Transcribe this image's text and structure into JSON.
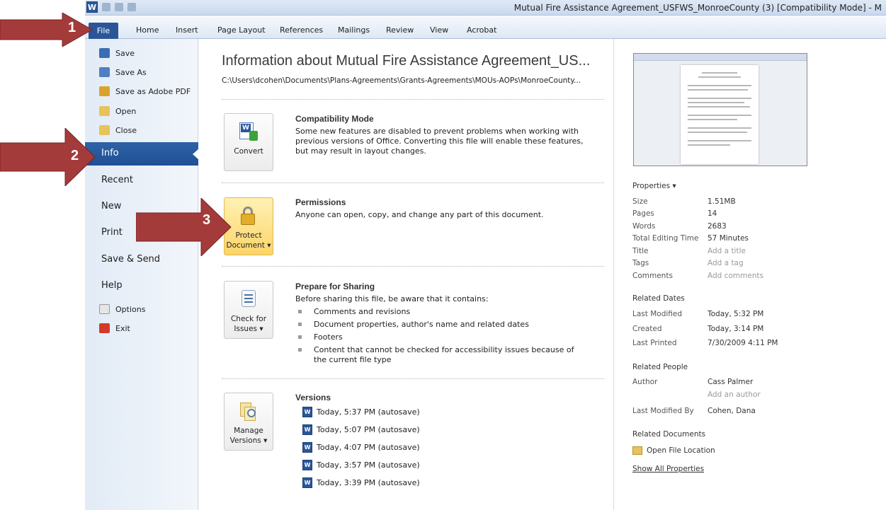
{
  "window": {
    "app_logo_letter": "W",
    "title": "Mutual Fire Assistance Agreement_USFWS_MonroeCounty (3) [Compatibility Mode] - M"
  },
  "ribbon": {
    "file_label": "File",
    "tabs": [
      "Home",
      "Insert",
      "Page Layout",
      "References",
      "Mailings",
      "Review",
      "View",
      "Acrobat"
    ]
  },
  "backstage_menu": {
    "commands": [
      {
        "label": "Save",
        "icon": "save-icon"
      },
      {
        "label": "Save As",
        "icon": "save-as-icon"
      },
      {
        "label": "Save as Adobe PDF",
        "icon": "adobe-pdf-icon"
      },
      {
        "label": "Open",
        "icon": "open-folder-icon"
      },
      {
        "label": "Close",
        "icon": "close-folder-icon"
      }
    ],
    "selected": "Info",
    "tabs": [
      "Recent",
      "New",
      "Print",
      "Save & Send",
      "Help"
    ],
    "bottom": [
      {
        "label": "Options",
        "icon": "options-icon"
      },
      {
        "label": "Exit",
        "icon": "exit-icon"
      }
    ]
  },
  "info": {
    "title": "Information about Mutual Fire Assistance Agreement_US...",
    "path": "C:\\Users\\dcohen\\Documents\\Plans-Agreements\\Grants-Agreements\\MOUs-AOPs\\MonroeCounty...",
    "compatibility": {
      "button": "Convert",
      "heading": "Compatibility Mode",
      "text": "Some new features are disabled to prevent problems when working with previous versions of Office. Converting this file will enable these features, but may result in layout changes."
    },
    "permissions": {
      "button_line1": "Protect",
      "button_line2": "Document",
      "heading": "Permissions",
      "text": "Anyone can open, copy, and change any part of this document."
    },
    "sharing": {
      "button_line1": "Check for",
      "button_line2": "Issues",
      "heading": "Prepare for Sharing",
      "text": "Before sharing this file, be aware that it contains:",
      "bullets": [
        "Comments and revisions",
        "Document properties, author's name and related dates",
        "Footers",
        "Content that cannot be checked for accessibility issues because of the current file type"
      ]
    },
    "versions": {
      "button_line1": "Manage",
      "button_line2": "Versions",
      "heading": "Versions",
      "items": [
        "Today, 5:37 PM (autosave)",
        "Today, 5:07 PM (autosave)",
        "Today, 4:07 PM (autosave)",
        "Today, 3:57 PM (autosave)",
        "Today, 3:39 PM (autosave)"
      ]
    }
  },
  "properties": {
    "heading": "Properties",
    "rows": [
      {
        "label": "Size",
        "value": "1.51MB",
        "muted": false
      },
      {
        "label": "Pages",
        "value": "14",
        "muted": false
      },
      {
        "label": "Words",
        "value": "2683",
        "muted": false
      },
      {
        "label": "Total Editing Time",
        "value": "57 Minutes",
        "muted": false
      },
      {
        "label": "Title",
        "value": "Add a title",
        "muted": true
      },
      {
        "label": "Tags",
        "value": "Add a tag",
        "muted": true
      },
      {
        "label": "Comments",
        "value": "Add comments",
        "muted": true
      }
    ],
    "related_dates": {
      "heading": "Related Dates",
      "rows": [
        {
          "label": "Last Modified",
          "value": "Today, 5:32 PM"
        },
        {
          "label": "Created",
          "value": "Today, 3:14 PM"
        },
        {
          "label": "Last Printed",
          "value": "7/30/2009 4:11 PM"
        }
      ]
    },
    "related_people": {
      "heading": "Related People",
      "author_label": "Author",
      "author_value": "Cass Palmer",
      "add_author": "Add an author",
      "last_modified_by_label": "Last Modified By",
      "last_modified_by_value": "Cohen, Dana"
    },
    "related_documents": {
      "heading": "Related Documents",
      "open_location": "Open File Location",
      "show_all": "Show All Properties"
    }
  },
  "callouts": [
    "1",
    "2",
    "3"
  ],
  "colors": {
    "arrow": "#a43b3b",
    "selected_tab": "#2a5699",
    "highlight_button": "#fcd568"
  }
}
